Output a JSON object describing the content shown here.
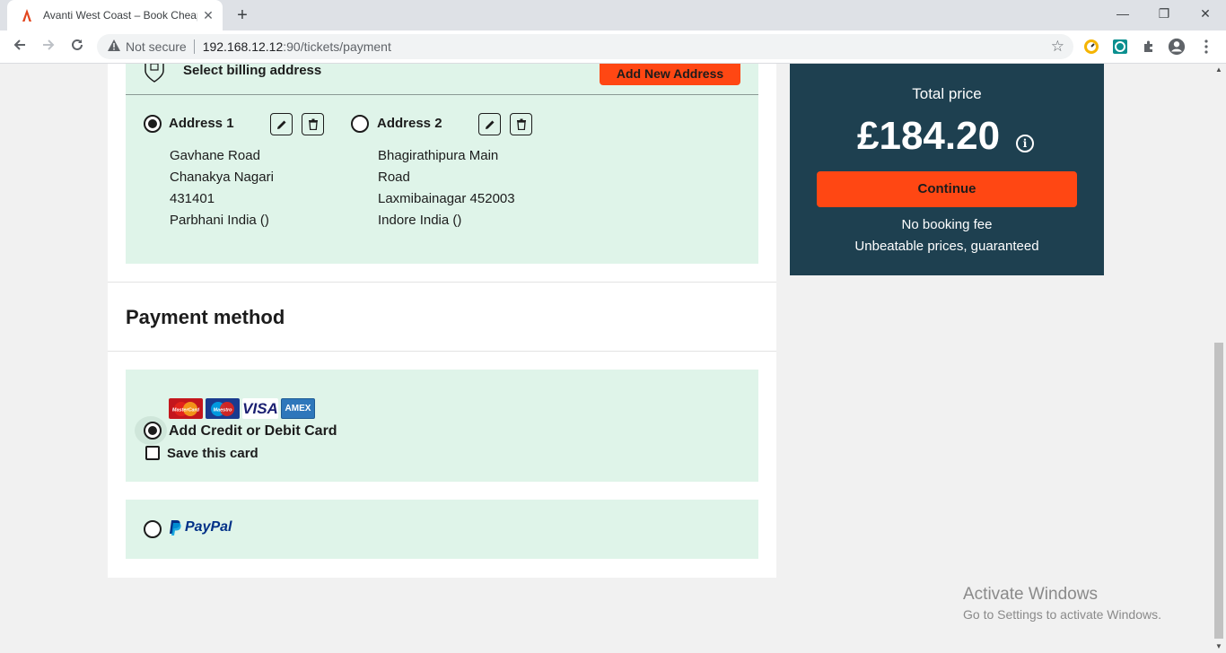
{
  "browser": {
    "tab_title": "Avanti West Coast – Book Cheap",
    "tab_close": "✕",
    "new_tab": "+",
    "security_label": "Not secure",
    "url_host": "192.168.12.12",
    "url_path": ":90/tickets/payment",
    "win_min": "—",
    "win_restore": "❐",
    "win_close": "✕"
  },
  "billing": {
    "title": "Select billing address",
    "add_button": "Add New Address",
    "addresses": [
      {
        "label": "Address 1",
        "selected": true,
        "lines": [
          "Gavhane Road",
          "Chanakya Nagari",
          "431401",
          "Parbhani India ()"
        ]
      },
      {
        "label": "Address 2",
        "selected": false,
        "lines": [
          "Bhagirathipura Main",
          "Road",
          "Laxmibainagar 452003",
          "Indore India ()"
        ]
      }
    ]
  },
  "payment": {
    "title": "Payment method",
    "card_option": "Add Credit or Debit Card",
    "save_card": "Save this card",
    "card_logos": [
      "MasterCard",
      "Maestro",
      "VISA",
      "AMEX"
    ],
    "paypal_label": "PayPal"
  },
  "summary": {
    "total_label": "Total price",
    "total_amount": "£184.20",
    "continue": "Continue",
    "no_fee": "No booking fee",
    "guarantee": "Unbeatable prices, guaranteed"
  },
  "watermark": {
    "title": "Activate Windows",
    "subtitle": "Go to Settings to activate Windows."
  },
  "colors": {
    "accent": "#ff4713",
    "panel_green": "#dff4e9",
    "summary_bg": "#1e4050"
  }
}
